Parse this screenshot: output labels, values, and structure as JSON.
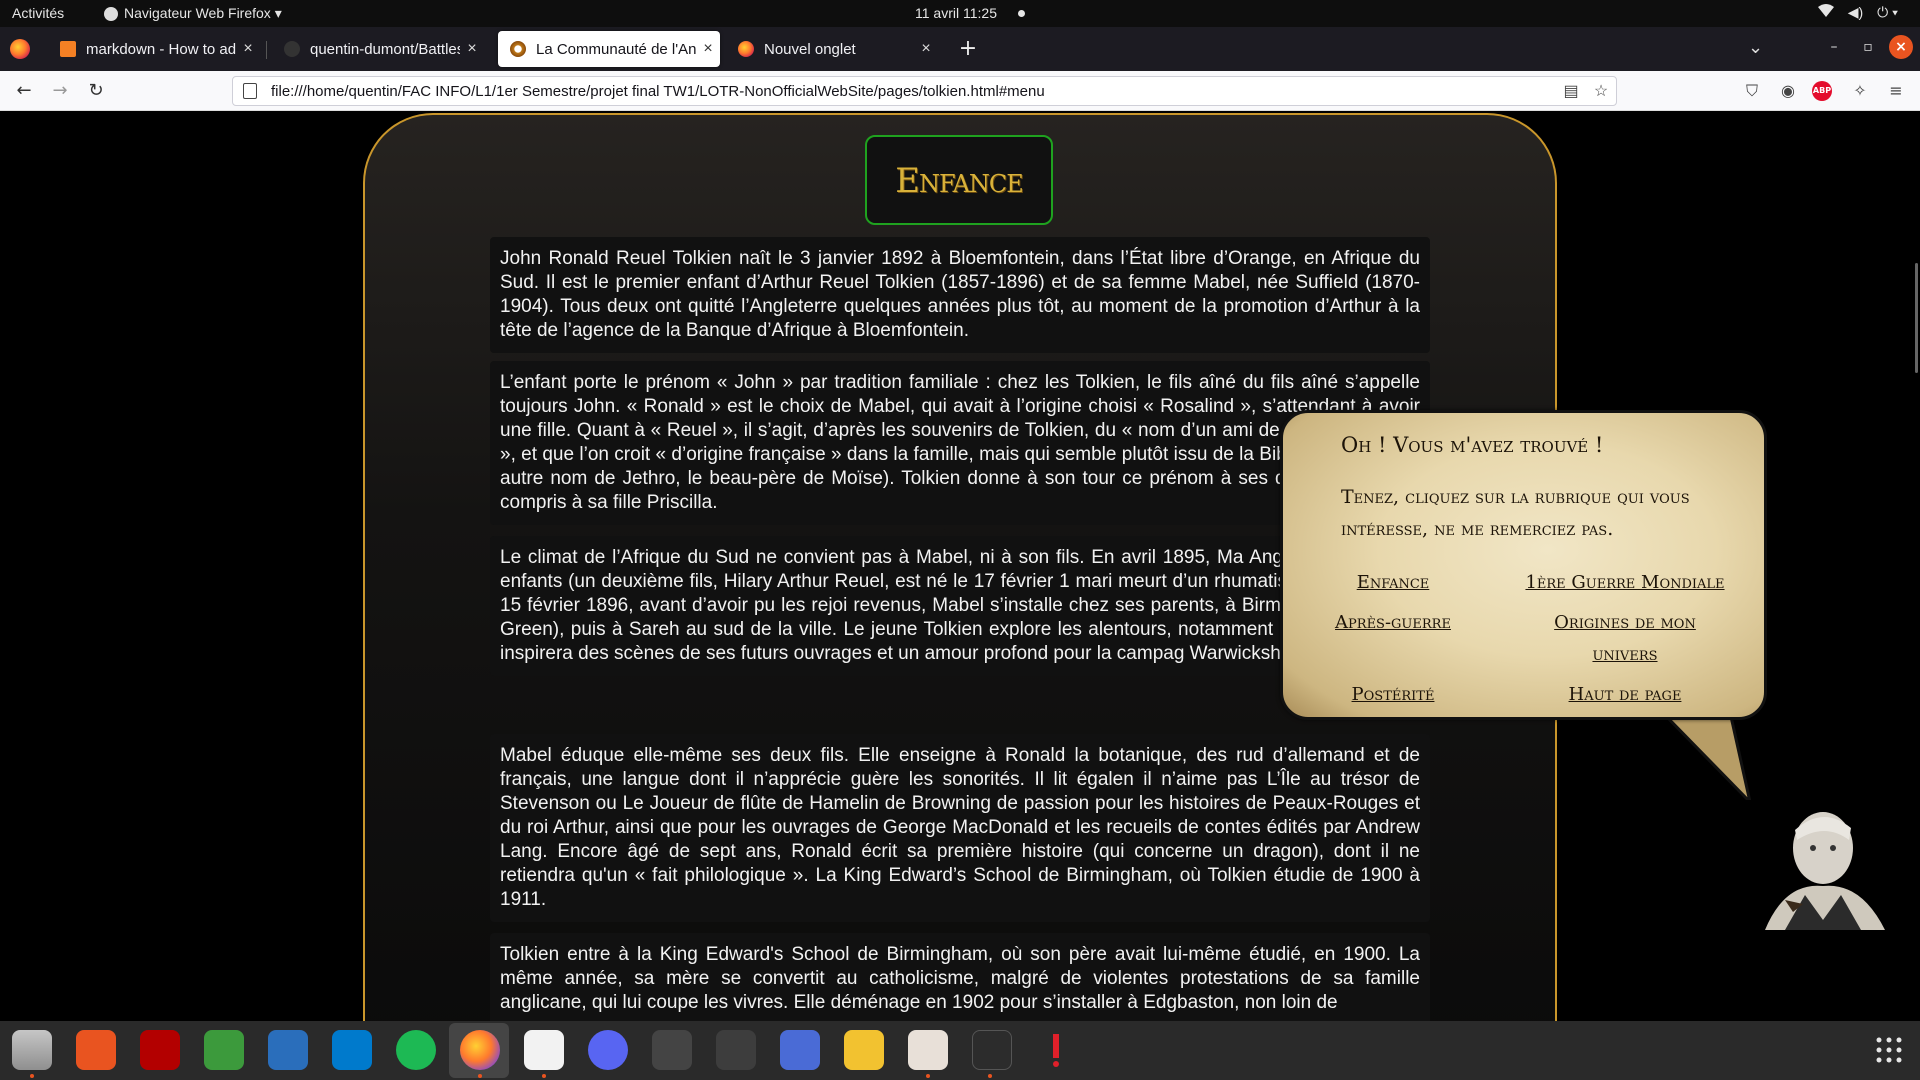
{
  "gnome": {
    "activities": "Activités",
    "app_name": "Navigateur Web Firefox ▾",
    "clock": "11 avril  11:25",
    "tray": {
      "network": "▾",
      "volume": "◀)",
      "power": "⏻ ▾"
    }
  },
  "browser": {
    "tabs": [
      {
        "label": "markdown - How to add i",
        "active": false
      },
      {
        "label": "quentin-dumont/Battles",
        "active": false
      },
      {
        "label": "La Communauté de l'Ann",
        "active": true
      },
      {
        "label": "Nouvel onglet",
        "active": false
      }
    ],
    "close_glyph": "×",
    "new_tab_glyph": "+",
    "url": "file:///home/quentin/FAC INFO/L1/1er Semestre/projet final TW1/LOTR-NonOfficialWebSite/pages/tolkien.html#menu",
    "abp_label": "ABP"
  },
  "page": {
    "section_title": "Enfance",
    "paragraphs": [
      "John Ronald Reuel Tolkien naît le 3 janvier 1892 à Bloemfontein, dans l’État libre d’Orange, en Afrique du Sud. Il est le premier enfant d’Arthur Reuel Tolkien (1857-1896) et de sa femme Mabel, née Suffield (1870-1904). Tous deux ont quitté l’Angleterre quelques années plus tôt, au moment de la promotion d’Arthur à la tête de l’agence de la Banque d’Afrique à Bloemfontein.",
      "L’enfant porte le prénom « John » par tradition familiale : chez les Tolkien, le fils aîné du fils aîné s’appelle toujours John. « Ronald » est le choix de Mabel, qui avait à l’origine choisi « Rosalind », s’attendant à avoir une fille. Quant à « Reuel », il s’agit, d’après les souvenirs de Tolkien, du « nom d’un ami de [sa] grand-mère », et que l’on croit « d’origine française » dans la famille, mais qui semble plutôt issu de la Bible (Reuel est un autre nom de Jethro, le beau-père de Moïse). Tolkien donne à son tour ce prénom à ses quatre enfants, y compris à sa fille Priscilla.",
      "Le climat de l’Afrique du Sud ne convient pas à Mabel, ni à son fils. En avril 1895, Ma Angleterre avec ses enfants (un deuxième fils, Hilary Arthur Reuel, est né le 17 février 1 mari meurt d’un rhumatisme infectieux le 15 février 1896, avant d’avoir pu les rejoi revenus, Mabel s’installe chez ses parents, à Birmingham (à Wake Green), puis à Sareh au sud de la ville. Le jeune Tolkien explore les alentours, notamment le moulin de Sar inspirera des scènes de ses futurs ouvrages et un amour profond pour la campag Warwickshire.",
      "Mabel éduque elle-même ses deux fils. Elle enseigne à Ronald la botanique, des rud d’allemand et de français, une langue dont il n’apprécie guère les sonorités. Il lit égalen il n’aime pas L’Île au trésor de Stevenson ou Le Joueur de flûte de Hamelin de Browning de passion pour les histoires de Peaux-Rouges et du roi Arthur, ainsi que pour les ouvrages de George MacDonald et les recueils de contes édités par Andrew Lang. Encore âgé de sept ans, Ronald écrit sa première histoire (qui concerne un dragon), dont il ne retiendra qu'un « fait philologique ». La King Edward’s School de Birmingham, où Tolkien étudie de 1900 à 1911.",
      "Tolkien entre à la King Edward's School de Birmingham, où son père avait lui-même étudié, en 1900. La même année, sa mère se convertit au catholicisme, malgré de violentes protestations de sa famille anglicane, qui lui coupe les vivres. Elle déménage en 1902 pour s’installer à Edgbaston, non loin de"
    ],
    "bubble": {
      "greeting": "Oh ! Vous m'avez trouvé !",
      "intro": "Tenez, cliquez sur la rubrique qui vous intéresse, ne me remerciez pas.",
      "links": {
        "enfance": "Enfance",
        "ww1": "1ère Guerre Mondiale",
        "apres": "Après-guerre",
        "origines": "Origines de mon univers",
        "posterite": "Postérité",
        "haut": "Haut de page"
      }
    }
  },
  "colors": {
    "frame_gold": "#c9962b",
    "title_green": "#1fa21f",
    "title_gold": "#d9b23a",
    "ubuntu_orange": "#e95420"
  },
  "dock": {
    "apps": [
      "files-icon",
      "app-center-icon",
      "filezilla-icon",
      "cloud-download-icon",
      "libreoffice-writer-icon",
      "vscode-icon",
      "spotify-icon",
      "firefox-icon",
      "text-editor-icon",
      "discord-icon",
      "geogebra-icon",
      "gimp-icon",
      "screenshot-icon",
      "calculator-icon",
      "document-viewer-icon",
      "terminal-icon",
      "alert-icon"
    ]
  }
}
